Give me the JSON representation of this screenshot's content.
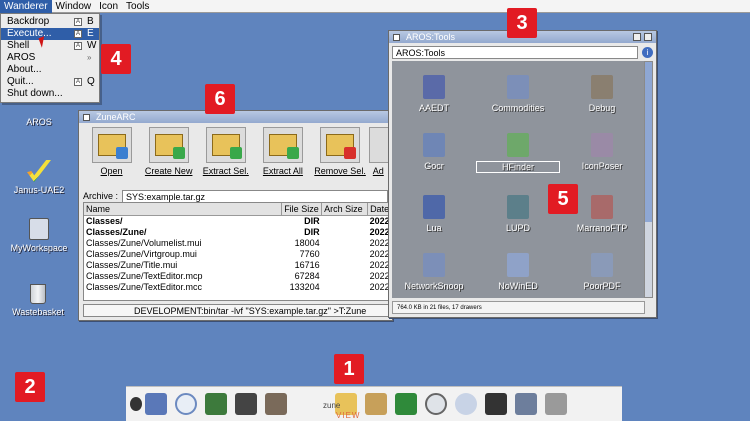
{
  "menubar": {
    "items": [
      "Wanderer",
      "Window",
      "Icon",
      "Tools"
    ]
  },
  "wanderer_menu": {
    "items": [
      {
        "label": "Backdrop",
        "shortcut": "B"
      },
      {
        "label": "Execute...",
        "shortcut": "E"
      },
      {
        "label": "Shell",
        "shortcut": "W"
      },
      {
        "label": "AROS",
        "shortcut": ""
      },
      {
        "label": "About...",
        "shortcut": ""
      },
      {
        "label": "Quit...",
        "shortcut": "Q"
      },
      {
        "label": "Shut down...",
        "shortcut": ""
      }
    ]
  },
  "desktop_icons": [
    "AROS",
    "Janus-UAE2",
    "MyWorkspace",
    "Wastebasket"
  ],
  "zunearc": {
    "title": "ZuneARC",
    "toolbar": [
      "Open",
      "Create New",
      "Extract Sel.",
      "Extract All",
      "Remove Sel.",
      "Ad"
    ],
    "archive_label": "Archive :",
    "archive_value": "SYS:example.tar.gz",
    "columns": [
      "Name",
      "File Size",
      "Arch Size",
      "Date"
    ],
    "rows": [
      {
        "name": "Classes/",
        "size": "DIR",
        "arch": "",
        "date": "2022",
        "bold": true
      },
      {
        "name": "Classes/Zune/",
        "size": "DIR",
        "arch": "",
        "date": "2022",
        "bold": true
      },
      {
        "name": "Classes/Zune/Volumelist.mui",
        "size": "18004",
        "arch": "",
        "date": "2022",
        "bold": false
      },
      {
        "name": "Classes/Zune/Virtgroup.mui",
        "size": "7760",
        "arch": "",
        "date": "2022",
        "bold": false
      },
      {
        "name": "Classes/Zune/Title.mui",
        "size": "16716",
        "arch": "",
        "date": "2022",
        "bold": false
      },
      {
        "name": "Classes/Zune/TextEditor.mcp",
        "size": "67284",
        "arch": "",
        "date": "2022",
        "bold": false
      },
      {
        "name": "Classes/Zune/TextEditor.mcc",
        "size": "133204",
        "arch": "",
        "date": "2022",
        "bold": false
      }
    ],
    "command": "DEVELOPMENT:bin/tar -lvf \"SYS:example.tar.gz\" >T:Zune"
  },
  "tools_window": {
    "title": "AROS:Tools",
    "path": "AROS:Tools",
    "icons": [
      "AAEDT",
      "Commodities",
      "Debug",
      "Gocr",
      "HFinder",
      "IconPoser",
      "Lua",
      "LUPD",
      "MarranoFTP",
      "NetworkSnoop",
      "NoWinED",
      "PoorPDF"
    ],
    "selected": "HFinder",
    "status": "764.0 KB in 21 files, 17 drawers"
  },
  "dock": {
    "zune_text": "zune",
    "view_text": "VIEW"
  },
  "callouts": [
    "1",
    "2",
    "3",
    "4",
    "5",
    "6"
  ]
}
